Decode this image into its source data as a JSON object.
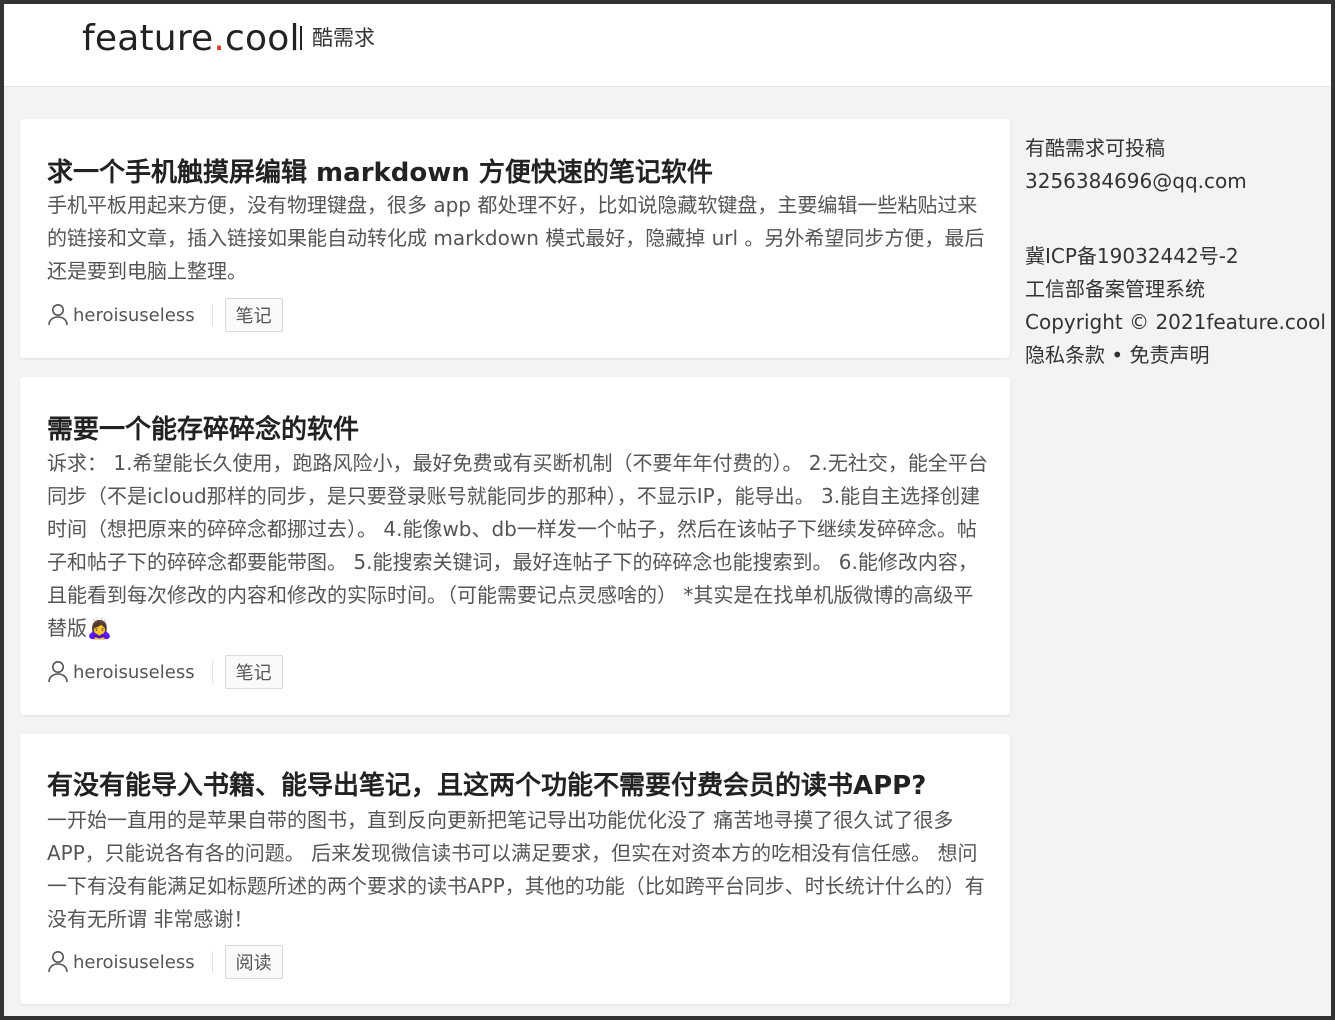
{
  "header": {
    "logo_main": "feature",
    "logo_dot": ".",
    "logo_tld": "cool",
    "logo_sub": "酷需求",
    "accent_color": "#e03a1e"
  },
  "posts": [
    {
      "title": "求一个手机触摸屏编辑 markdown 方便快速的笔记软件",
      "body": "手机平板用起来方便，没有物理键盘，很多 app 都处理不好，比如说隐藏软键盘，主要编辑一些粘贴过来的链接和文章，插入链接如果能自动转化成 markdown 模式最好，隐藏掉 url 。另外希望同步方便，最后还是要到电脑上整理。",
      "author": "heroisuseless",
      "tag": "笔记"
    },
    {
      "title": "需要一个能存碎碎念的软件",
      "body": "诉求： 1.希望能长久使用，跑路风险小，最好免费或有买断机制（不要年年付费的）。 2.无社交，能全平台同步（不是icloud那样的同步，是只要登录账号就能同步的那种），不显示IP，能导出。 3.能自主选择创建时间（想把原来的碎碎念都挪过去）。 4.能像wb、db一样发一个帖子，然后在该帖子下继续发碎碎念。帖子和帖子下的碎碎念都要能带图。 5.能搜索关键词，最好连帖子下的碎碎念也能搜索到。 6.能修改内容，且能看到每次修改的内容和修改的实际时间。（可能需要记点灵感啥的） *其实是在找单机版微博的高级平替版🙇‍♀️",
      "author": "heroisuseless",
      "tag": "笔记"
    },
    {
      "title": "有没有能导入书籍、能导出笔记，且这两个功能不需要付费会员的读书APP?",
      "body": "一开始一直用的是苹果自带的图书，直到反向更新把笔记导出功能优化没了 痛苦地寻摸了很久试了很多APP，只能说各有各的问题。 后来发现微信读书可以满足要求，但实在对资本方的吃相没有信任感。 想问一下有没有能满足如标题所述的两个要求的读书APP，其他的功能（比如跨平台同步、时长统计什么的）有没有无所谓 非常感谢！",
      "author": "heroisuseless",
      "tag": "阅读"
    }
  ],
  "sidebar": {
    "submit_text": "有酷需求可投稿",
    "email": "3256384696@qq.com",
    "icp": "冀ICP备19032442号-2",
    "miit": "工信部备案管理系统",
    "copyright": "Copyright © 2021feature.cool",
    "privacy": "隐私条款",
    "bullet": " • ",
    "disclaimer": "免责声明"
  }
}
